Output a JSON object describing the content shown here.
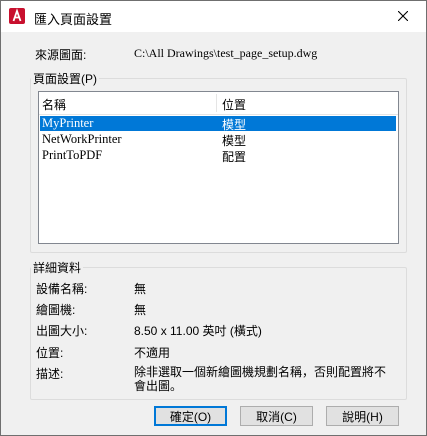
{
  "window": {
    "title": "匯入頁面設置",
    "app_icon": "autocad-icon",
    "close_icon": "close-icon"
  },
  "source": {
    "label": "來源圖面:",
    "value": "C:\\All Drawings\\test_page_setup.dwg"
  },
  "page_setups": {
    "group_title": "頁面設置(P)",
    "columns": [
      "名稱",
      "位置"
    ],
    "rows": [
      {
        "name": "MyPrinter",
        "location": "模型",
        "selected": true
      },
      {
        "name": "NetWorkPrinter",
        "location": "模型",
        "selected": false
      },
      {
        "name": "PrintToPDF",
        "location": "配置",
        "selected": false
      }
    ]
  },
  "details": {
    "group_title": "詳細資料",
    "device_label": "設備名稱:",
    "device_value": "無",
    "plotter_label": "繪圖機:",
    "plotter_value": "無",
    "size_label": "出圖大小:",
    "size_value": "8.50 x 11.00 英吋 (橫式)",
    "location_label": "位置:",
    "location_value": "不適用",
    "description_label": "描述:",
    "description_value": "除非選取一個新繪圖機規劃名稱，否則配置將不會出圖。"
  },
  "buttons": {
    "ok": "確定(O)",
    "cancel": "取消(C)",
    "help": "說明(H)"
  },
  "colors": {
    "selection": "#0078d7",
    "app_icon_red": "#c8102e"
  }
}
